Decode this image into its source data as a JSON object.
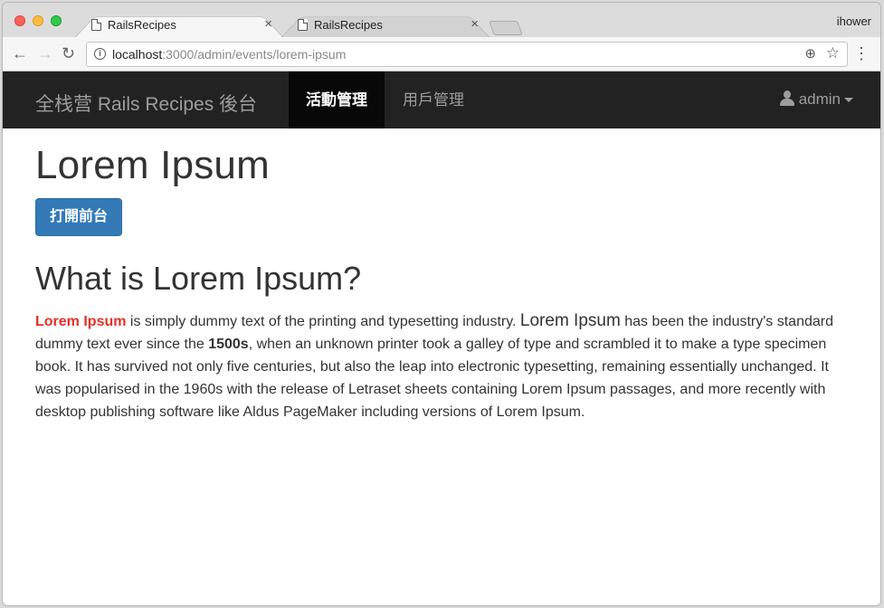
{
  "browser": {
    "tabs": [
      {
        "label": "RailsRecipes",
        "close": "×"
      },
      {
        "label": "RailsRecipes",
        "close": "×"
      }
    ],
    "profile": "ihower",
    "url_host": "localhost",
    "url_path": ":3000/admin/events/lorem-ipsum"
  },
  "navbar": {
    "brand": "全栈营 Rails Recipes 後台",
    "items": [
      {
        "label": "活動管理",
        "active": true
      },
      {
        "label": "用戶管理",
        "active": false
      }
    ],
    "user": "admin"
  },
  "main": {
    "title": "Lorem Ipsum",
    "button_label": "打開前台",
    "heading": "What is Lorem Ipsum?",
    "para": {
      "hl": "Lorem Ipsum",
      "t1": " is simply dummy text of the printing and typesetting industry. ",
      "big": "Lorem Ipsum",
      "t2": " has been the industry's standard dummy text ever since the ",
      "bold": "1500s",
      "t3": ", when an unknown printer took a galley of type and scrambled it to make a type specimen book. It has survived not only five centuries, but also the leap into electronic typesetting, remaining essentially unchanged. It was popularised in the 1960s with the release of Letraset sheets containing Lorem Ipsum passages, and more recently with desktop publishing software like Aldus PageMaker including versions of Lorem Ipsum."
    }
  },
  "colors": {
    "navbar_bg": "#222222",
    "button_bg": "#337ab7",
    "highlight": "#e52f25"
  }
}
